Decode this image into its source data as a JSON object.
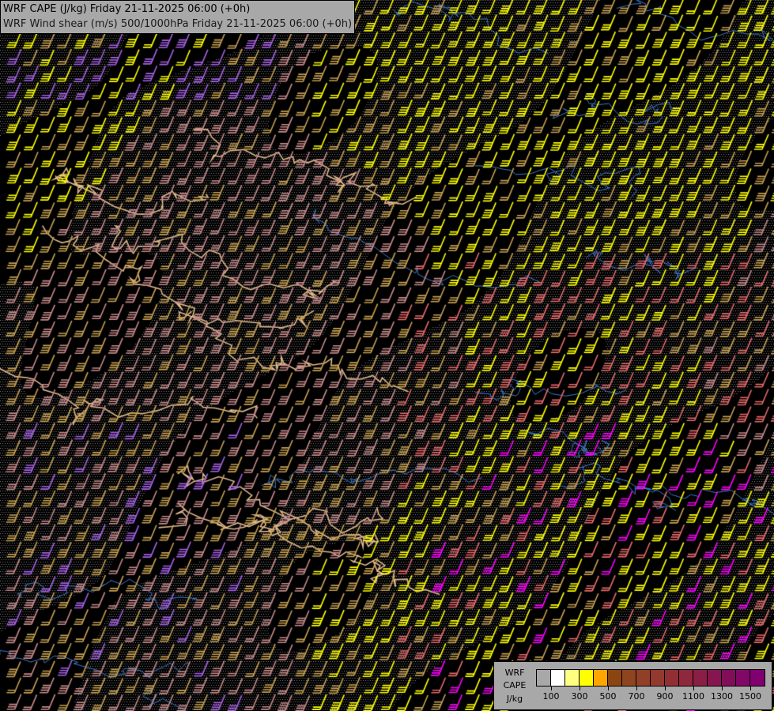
{
  "title": {
    "line1": "WRF CAPE (J/kg) Friday 21-11-2025 06:00 (+0h)",
    "line2": "WRF Wind shear (m/s) 500/1000hPa Friday 21-11-2025 06:00 (+0h)"
  },
  "legend": {
    "label1": "WRF",
    "label2": "CAPE",
    "label3": "J/kg",
    "colors": [
      "transparent",
      "#ffffff",
      "#ffff80",
      "#ffff00",
      "#ffa500",
      "#8b4513",
      "#8f4420",
      "#923f28",
      "#93392d",
      "#922f34",
      "#8f283c",
      "#8a1e45",
      "#851650",
      "#820e5a",
      "#800866",
      "#800070"
    ],
    "ticks": [
      "100",
      "300",
      "500",
      "700",
      "900",
      "1100",
      "1300",
      "1500"
    ]
  },
  "barb_colors": {
    "yellow": "#ffff00",
    "tan": "#c8a050",
    "pink": "#c88a8a",
    "salmon": "#e86a6a",
    "violet": "#a860e8",
    "magenta": "#ff00ff",
    "border": "#e0b88c",
    "river": "#3a7acc"
  }
}
